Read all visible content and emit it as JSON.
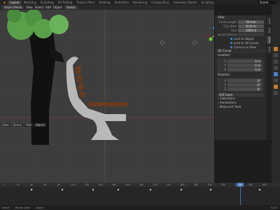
{
  "topbar": {
    "tabs": [
      "Layout",
      "Modeling",
      "Sculpting",
      "UV Editing",
      "Texture Paint",
      "Shading",
      "Animation",
      "Rendering",
      "Compositing",
      "Geometry Nodes",
      "Scripting"
    ],
    "active_tab": "Layout",
    "scene": "Scene"
  },
  "viewport_header": {
    "mode": "Object Mode",
    "items": [
      "View",
      "Select",
      "Add",
      "Object"
    ],
    "transform": "Global"
  },
  "viewport_footer": {
    "items": [
      "View",
      "Select",
      "Add",
      "Object"
    ]
  },
  "npanel": {
    "section": "View",
    "rows": [
      {
        "label": "Focal Length",
        "value": "50 mm"
      },
      {
        "label": "Clip Start",
        "value": "0.01 m"
      },
      {
        "label": "End",
        "value": "1000 m"
      }
    ],
    "local_camera": "Local Camera",
    "lock_label": "Lock to Object",
    "lock_to_3d_cursor": "Lock to 3D Cursor",
    "lock_camera_to_view": "Camera to View",
    "cursor_section": "3D Cursor",
    "location_label": "Location:",
    "location": [
      {
        "axis": "X",
        "value": "0 m"
      },
      {
        "axis": "Y",
        "value": "0 m"
      },
      {
        "axis": "Z",
        "value": "0 m"
      }
    ],
    "rotation_label": "Rotation:",
    "rotation": [
      {
        "axis": "X",
        "value": "0°"
      },
      {
        "axis": "Y",
        "value": "0°"
      },
      {
        "axis": "Z",
        "value": "0°"
      }
    ],
    "rotation_mode": "XYZ Euler",
    "collapsed": [
      "Collections",
      "Annotations",
      "Measureit Tools"
    ]
  },
  "vertical_tabs": [
    "Item",
    "Tool",
    "View",
    "Edit"
  ],
  "timeline": {
    "ticks": [
      "0",
      "20",
      "40",
      "60",
      "80",
      "100",
      "120",
      "140",
      "160",
      "180",
      "200",
      "220",
      "240",
      "260",
      "280",
      "300",
      "320",
      "340",
      "360",
      "380"
    ],
    "current_frame": "340"
  },
  "statusbar": {
    "left": "Select",
    "middle": "Rotate View",
    "right": "Object",
    "version": "3.0.0"
  }
}
